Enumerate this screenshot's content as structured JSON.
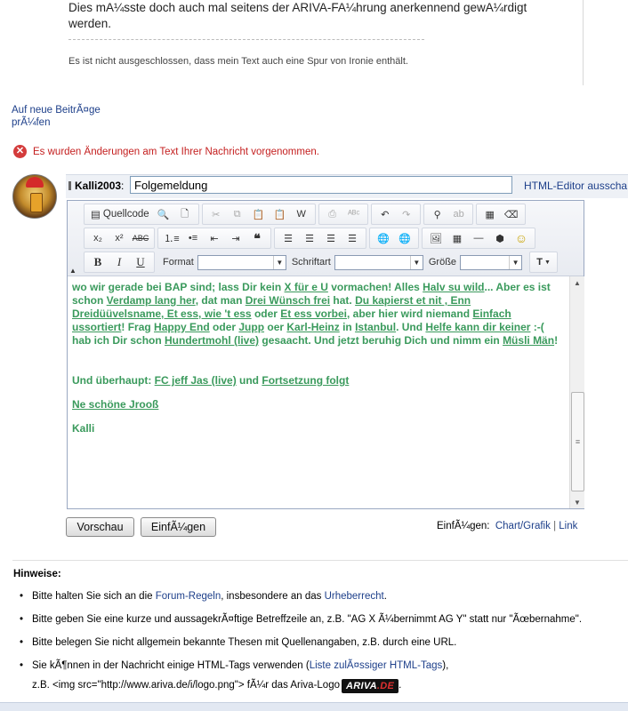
{
  "quote": {
    "text": "Dies mA¼sste doch auch mal seitens der ARIVA-FA¼hrung anerkennend gewA¼rdigt werden.",
    "signature": "Es ist nicht ausgeschlossen, dass mein Text auch eine Spur von Ironie enthält."
  },
  "check_new_posts": "Auf neue BeitrÃ¤ge prÃ¼fen",
  "warning": {
    "icon": "error-x-icon",
    "text": "Es wurden Änderungen am Text Ihrer Nachricht vorgenommen.",
    "color": "#c41e1e"
  },
  "subject": {
    "user": "Kalli2003",
    "colon": ":",
    "value": "Folgemeldung",
    "html_editor_link": "HTML-Editor ausscha"
  },
  "toolbar": {
    "source_label": "Quellcode",
    "format_label": "Format",
    "font_label": "Schriftart",
    "size_label": "Größe",
    "format_value": "",
    "font_value": "",
    "size_value": ""
  },
  "content": {
    "color": "#3a9a5c",
    "p1": [
      {
        "t": "wo wir gerade bei BAP sind; lass Dir kein "
      },
      {
        "l": "X für e U"
      },
      {
        "t": " vormachen! Alles "
      },
      {
        "l": "Halv su wild"
      },
      {
        "t": "... Aber es ist schon "
      },
      {
        "l": "Verdamp lang her"
      },
      {
        "t": ", dat man "
      },
      {
        "l": "Drei Wünsch frei"
      },
      {
        "t": " hat. "
      },
      {
        "l": "Du kapierst et nit , Enn Dreidüüvelsname, Et ess, wie 't ess"
      },
      {
        "t": " oder "
      },
      {
        "l": "Et ess vorbei"
      },
      {
        "t": ", aber hier wird niemand "
      },
      {
        "l": "Einfach ussortiert"
      },
      {
        "t": "! Frag "
      },
      {
        "l": "Happy End"
      },
      {
        "t": " oder "
      },
      {
        "l": "Jupp"
      },
      {
        "t": " oer "
      },
      {
        "l": "Karl-Heinz"
      },
      {
        "t": " in "
      },
      {
        "l": "Istanbul"
      },
      {
        "t": ". Und "
      },
      {
        "l": "Helfe kann dir keiner"
      },
      {
        "t": " :-( hab ich Dir schon "
      },
      {
        "l": "Hundertmohl (live)"
      },
      {
        "t": " gesaacht. Und jetzt beruhig Dich und nimm ein "
      },
      {
        "l": "Müsli Män"
      },
      {
        "t": "!"
      }
    ],
    "p2": [
      {
        "t": "Und überhaupt: "
      },
      {
        "l": "FC jeff Jas (live)"
      },
      {
        "t": " und "
      },
      {
        "l": "Fortsetzung folgt"
      }
    ],
    "p3_link": "Ne schöne Jrooß",
    "p4": "Kalli"
  },
  "buttons": {
    "preview": "Vorschau",
    "insert": "EinfÃ¼gen"
  },
  "insert_links": {
    "label": "EinfÃ¼gen:",
    "chart": "Chart/Grafik",
    "sep": "|",
    "link": "Link"
  },
  "hints": {
    "title": "Hinweise:",
    "h1": {
      "pre": "Bitte halten Sie sich an die ",
      "link1": "Forum-Regeln",
      "mid": ", insbesondere an das ",
      "link2": "Urheberrecht",
      "post": "."
    },
    "h2": "Bitte geben Sie eine kurze und aussagekrÃ¤ftige Betreffzeile an, z.B. \"AG X Ã¼bernimmt AG Y\" statt nur \"Ãœbernahme\".",
    "h3": "Bitte belegen Sie nicht allgemein bekannte Thesen mit Quellenangaben, z.B. durch eine URL.",
    "h4": {
      "pre": "Sie kÃ¶nnen in der Nachricht einige HTML-Tags verwenden (",
      "link": "Liste zulÃ¤ssiger HTML-Tags",
      "post": "),",
      "line2": "z.B. <img src=\"http://www.ariva.de/i/logo.png\"> fÃ¼r das Ariva-Logo",
      "logo_a": "ARIVA",
      "logo_b": ".DE",
      "end": "."
    }
  }
}
